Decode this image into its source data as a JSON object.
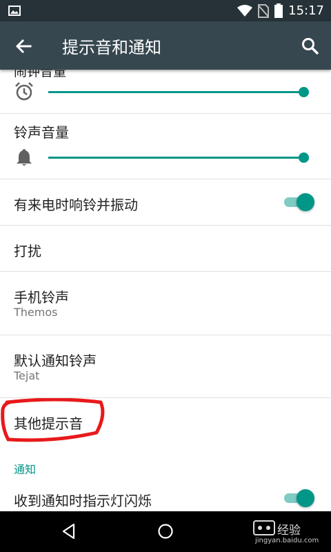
{
  "status_bar": {
    "time": "15:17",
    "icons": [
      "gallery-icon",
      "wifi-icon",
      "no-sim-icon",
      "battery-icon"
    ]
  },
  "app_bar": {
    "title": "提示音和通知",
    "back_icon": "arrow-back-icon",
    "search_icon": "search-icon"
  },
  "settings": {
    "peek_label": "闹钟音量",
    "alarm_volume": {
      "icon": "alarm-clock-icon",
      "level": 1.0
    },
    "ring_volume": {
      "label": "铃声音量",
      "icon": "bell-icon",
      "level": 1.0
    },
    "vibrate_on_ring": {
      "label": "有来电时响铃并振动",
      "enabled": true
    },
    "interruptions": {
      "label": "打扰"
    },
    "phone_ringtone": {
      "label": "手机铃声",
      "value": "Themos"
    },
    "default_notification_ringtone": {
      "label": "默认通知铃声",
      "value": "Tejat"
    },
    "other_sounds": {
      "label": "其他提示音"
    },
    "notification_section": {
      "header": "通知"
    },
    "pulse_notification_light": {
      "label": "收到通知时指示灯闪烁",
      "enabled": true
    }
  },
  "nav_bar": {
    "back_icon": "nav-back-icon",
    "home_icon": "nav-home-icon"
  },
  "watermark": {
    "text": "经验",
    "url": "jingyan.baidu.com"
  },
  "colors": {
    "status_bar": "#263238",
    "app_bar": "#37474F",
    "accent": "#009688",
    "accent_light": "#80cbc4",
    "highlight_mark": "#e8191b"
  }
}
